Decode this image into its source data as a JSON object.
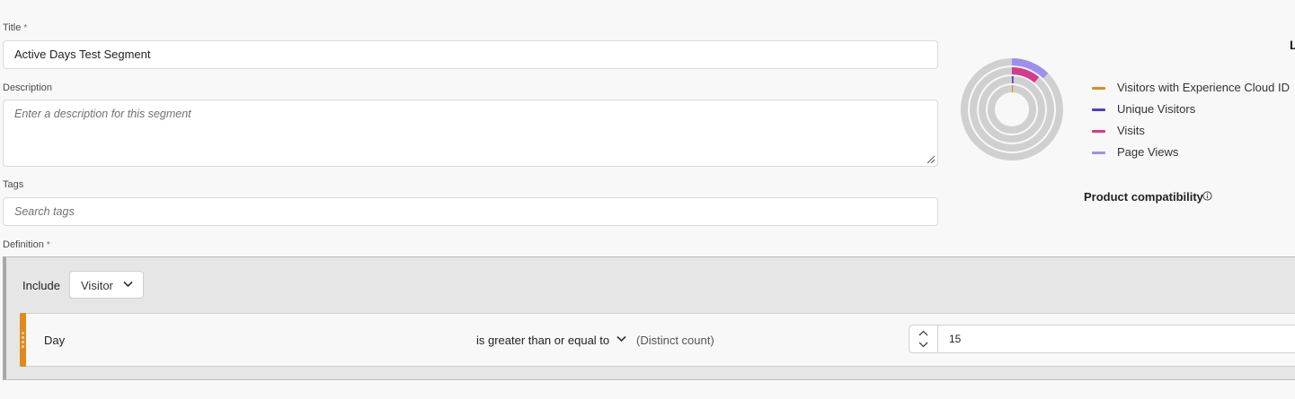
{
  "form": {
    "title": {
      "label": "Title",
      "required_mark": "*",
      "value": "Active Days Test Segment"
    },
    "description": {
      "label": "Description",
      "placeholder": "Enter a description for this segment"
    },
    "tags": {
      "label": "Tags",
      "placeholder": "Search tags"
    },
    "definition": {
      "label": "Definition",
      "required_mark": "*"
    }
  },
  "definition_builder": {
    "include_label": "Include",
    "scope": "Visitor",
    "rule": {
      "dimension": "Day",
      "operator": "is greater than or equal to",
      "qualifier": "(Distinct count)",
      "value": "15"
    }
  },
  "summary_panel": {
    "cut_off_heading_letter": "L",
    "legend": [
      {
        "label": "Visitors with Experience Cloud ID",
        "color": "#e08a1e"
      },
      {
        "label": "Unique Visitors",
        "color": "#4b3fc7"
      },
      {
        "label": "Visits",
        "color": "#d63a8b"
      },
      {
        "label": "Page Views",
        "color": "#9c8ff0"
      }
    ],
    "product_compatibility_label": "Product compatibility"
  }
}
